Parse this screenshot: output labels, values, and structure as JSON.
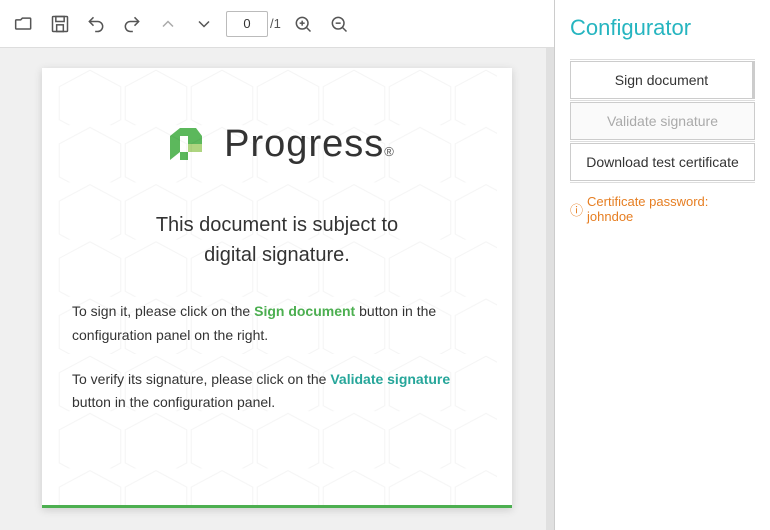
{
  "toolbar": {
    "page_input_value": "0",
    "page_total": "/1",
    "icons": {
      "folder": "📁",
      "save": "💾",
      "undo": "↩",
      "redo": "↪",
      "arrow_up": "↑",
      "arrow_down": "↓",
      "zoom_in": "+",
      "zoom_out": "−"
    }
  },
  "pdf": {
    "logo_text": "Progress",
    "logo_tm": "®",
    "title_line1": "This document is subject to",
    "title_line2": "digital signature.",
    "body1_prefix": "To sign it, please click on the ",
    "body1_highlight": "Sign document",
    "body1_suffix": " button\nin the configuration panel on the right.",
    "body2_prefix": "To verify its signature, please click on the\n",
    "body2_highlight": "Validate signature",
    "body2_suffix": " button in the configuration panel."
  },
  "configurator": {
    "title": "Configurator",
    "btn_sign": "Sign document",
    "btn_validate": "Validate signature",
    "btn_download": "Download test certificate",
    "cert_password_label": "Certificate password: johndoe",
    "cert_password_icon": "ⓘ"
  }
}
